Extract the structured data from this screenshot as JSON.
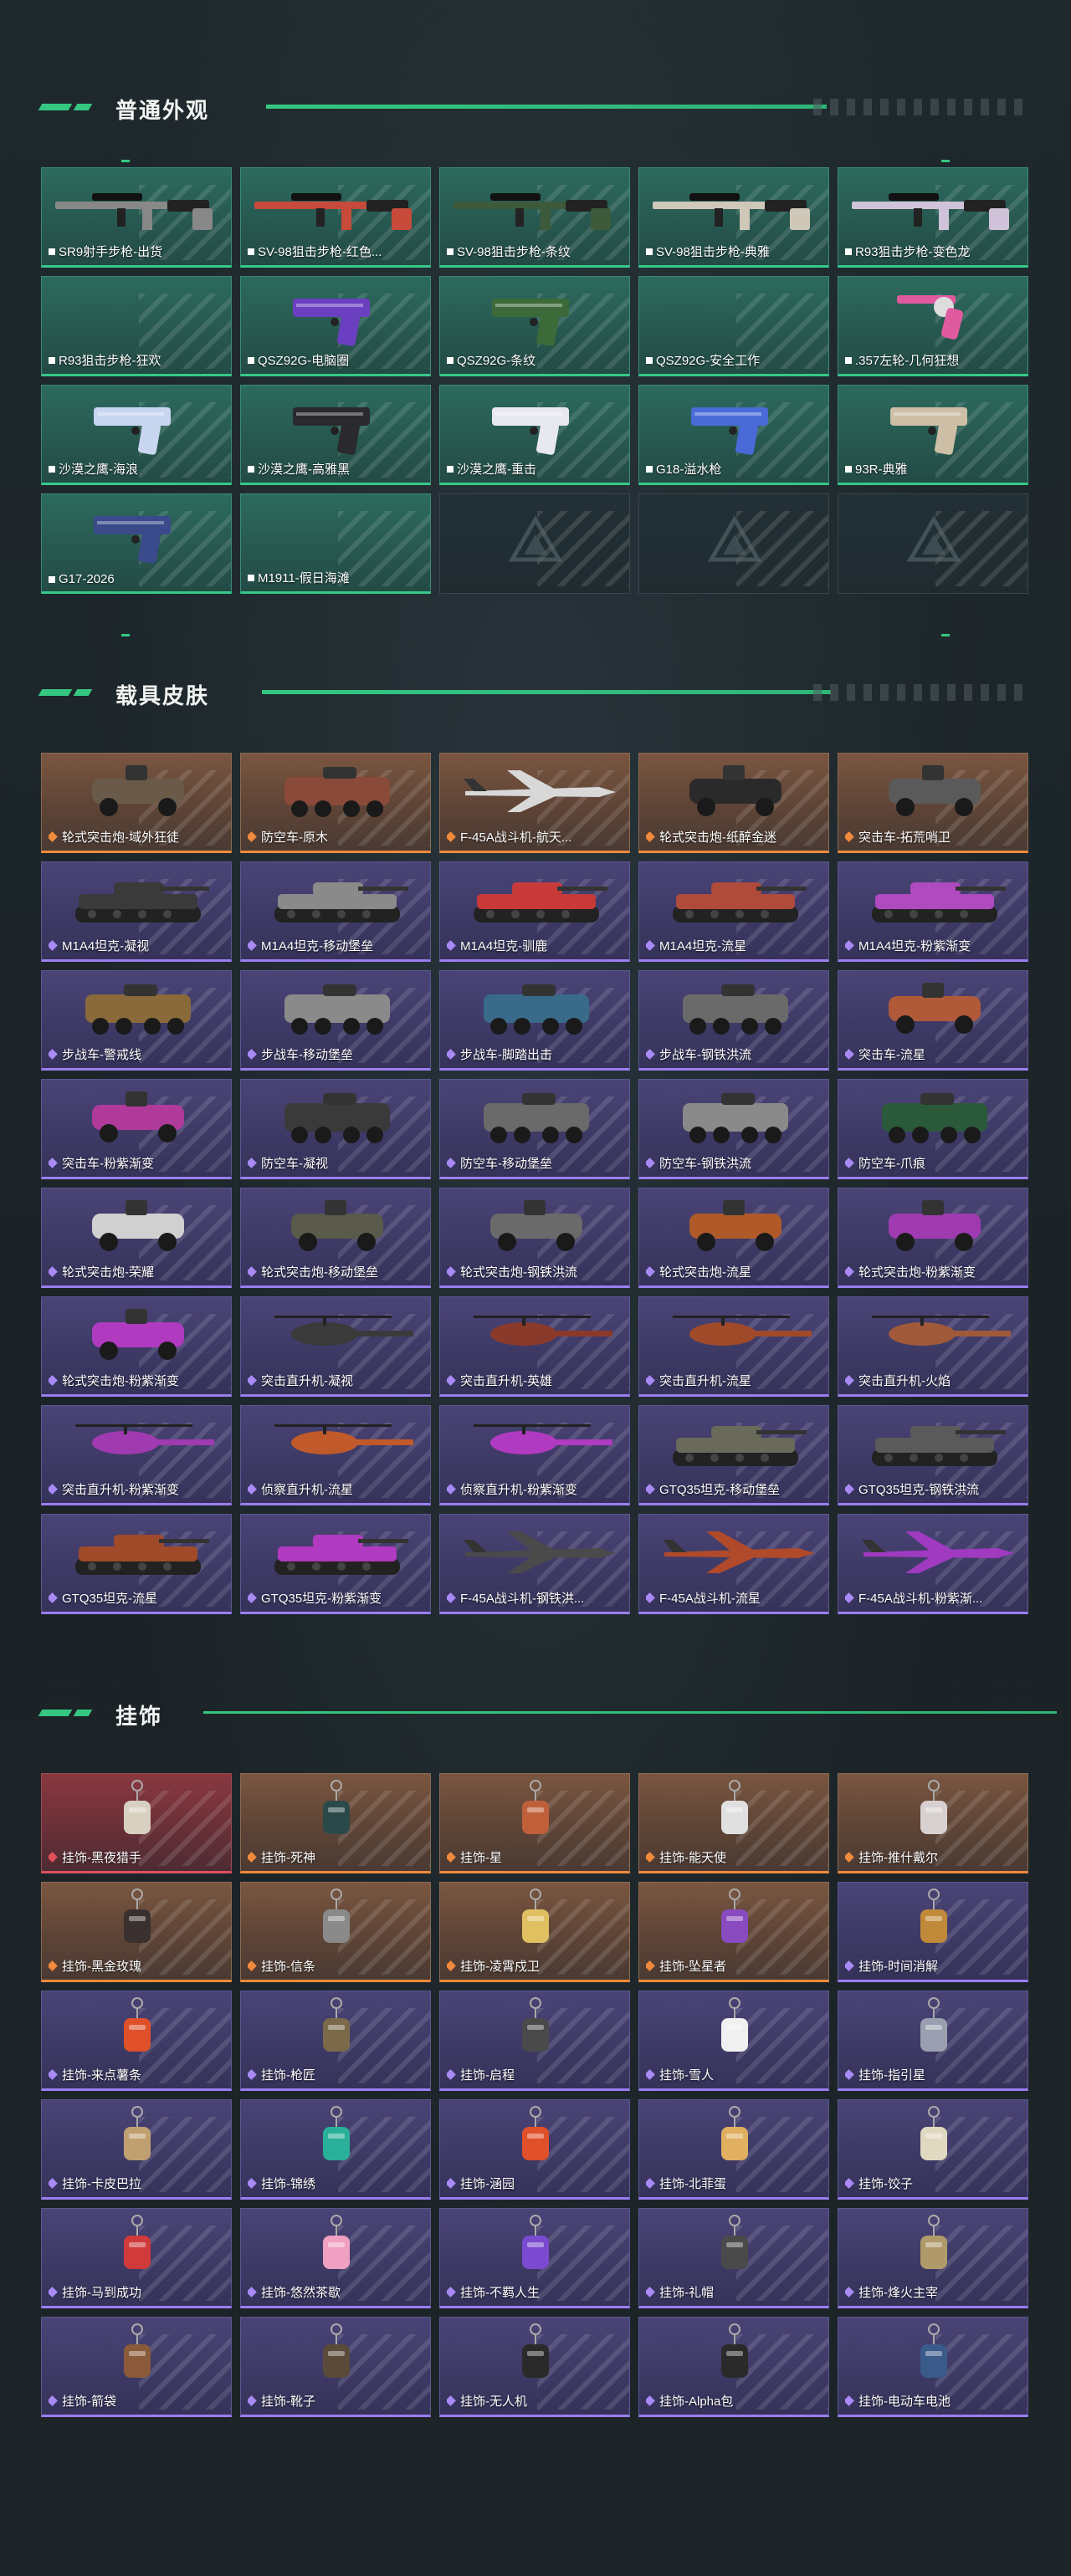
{
  "sections": [
    {
      "title": "普通外观",
      "items": [
        {
          "label": "SR9射手步枪-出货",
          "kind": "rifle",
          "tier": "g"
        },
        {
          "label": "SV-98狙击步枪-红色...",
          "kind": "rifle",
          "tier": "g",
          "color": "#c74a3a"
        },
        {
          "label": "SV-98狙击步枪-条纹",
          "kind": "rifle",
          "tier": "g",
          "color": "#3d5a3a"
        },
        {
          "label": "SV-98狙击步枪-典雅",
          "kind": "rifle",
          "tier": "g",
          "color": "#cfc7b8"
        },
        {
          "label": "R93狙击步枪-变色龙",
          "kind": "rifle",
          "tier": "g",
          "color": "#d0c2d8"
        },
        {
          "label": "R93狙击步枪-狂欢",
          "kind": "none",
          "tier": "g"
        },
        {
          "label": "QSZ92G-电脑圈",
          "kind": "pistol",
          "tier": "g",
          "color": "#6a3fc0"
        },
        {
          "label": "QSZ92G-条纹",
          "kind": "pistol",
          "tier": "g",
          "color": "#3c6a38"
        },
        {
          "label": "QSZ92G-安全工作",
          "kind": "none",
          "tier": "g"
        },
        {
          "label": ".357左轮-几何狂想",
          "kind": "revolver",
          "tier": "g",
          "color": "#e05aa0"
        },
        {
          "label": "沙漠之鹰-海浪",
          "kind": "pistol",
          "tier": "g",
          "color": "#c8d6f0"
        },
        {
          "label": "沙漠之鹰-高雅黑",
          "kind": "pistol",
          "tier": "g",
          "color": "#2a2a2e"
        },
        {
          "label": "沙漠之鹰-重击",
          "kind": "pistol",
          "tier": "g",
          "color": "#e8e8f0"
        },
        {
          "label": "G18-溢水枪",
          "kind": "pistol",
          "tier": "g",
          "color": "#4a6ad8"
        },
        {
          "label": "93R-典雅",
          "kind": "pistol",
          "tier": "g",
          "color": "#cdbfa6"
        },
        {
          "label": "G17-2026",
          "kind": "pistol",
          "tier": "g",
          "color": "#3a4a8a"
        },
        {
          "label": "M1911-假日海滩",
          "kind": "none",
          "tier": "g"
        },
        {
          "label": "",
          "kind": "empty",
          "tier": "e"
        },
        {
          "label": "",
          "kind": "empty",
          "tier": "e"
        },
        {
          "label": "",
          "kind": "empty",
          "tier": "e"
        }
      ]
    },
    {
      "title": "载具皮肤",
      "items": [
        {
          "label": "轮式突击炮-域外狂徒",
          "kind": "truck",
          "tier": "o",
          "color": "#6a5a4a"
        },
        {
          "label": "防空车-原木",
          "kind": "apc",
          "tier": "o",
          "color": "#8a4a3a"
        },
        {
          "label": "F-45A战斗机-航天...",
          "kind": "jet",
          "tier": "o",
          "color": "#d8d8d8"
        },
        {
          "label": "轮式突击炮-纸醉金迷",
          "kind": "truck",
          "tier": "o",
          "color": "#2a2a2a"
        },
        {
          "label": "突击车-拓荒哨卫",
          "kind": "truck",
          "tier": "o",
          "color": "#5a5a5a"
        },
        {
          "label": "M1A4坦克-凝视",
          "kind": "tank",
          "tier": "p",
          "color": "#3a3a3a"
        },
        {
          "label": "M1A4坦克-移动堡垒",
          "kind": "tank",
          "tier": "p",
          "color": "#8a8a8a"
        },
        {
          "label": "M1A4坦克-驯鹿",
          "kind": "tank",
          "tier": "p",
          "color": "#c83a3a"
        },
        {
          "label": "M1A4坦克-流星",
          "kind": "tank",
          "tier": "p",
          "color": "#b04a3a"
        },
        {
          "label": "M1A4坦克-粉紫渐变",
          "kind": "tank",
          "tier": "p",
          "color": "#b04ac0"
        },
        {
          "label": "步战车-警戒线",
          "kind": "apc",
          "tier": "p",
          "color": "#8a6a3a"
        },
        {
          "label": "步战车-移动堡垒",
          "kind": "apc",
          "tier": "p",
          "color": "#8a8a8a"
        },
        {
          "label": "步战车-脚踏出击",
          "kind": "apc",
          "tier": "p",
          "color": "#3a6a8a"
        },
        {
          "label": "步战车-钢铁洪流",
          "kind": "apc",
          "tier": "p",
          "color": "#6a6a6a"
        },
        {
          "label": "突击车-流星",
          "kind": "truck",
          "tier": "p",
          "color": "#b05a3a"
        },
        {
          "label": "突击车-粉紫渐变",
          "kind": "truck",
          "tier": "p",
          "color": "#b03a9a"
        },
        {
          "label": "防空车-凝视",
          "kind": "apc",
          "tier": "p",
          "color": "#3a3a3a"
        },
        {
          "label": "防空车-移动堡垒",
          "kind": "apc",
          "tier": "p",
          "color": "#6a6a6a"
        },
        {
          "label": "防空车-钢铁洪流",
          "kind": "apc",
          "tier": "p",
          "color": "#8a8a8a"
        },
        {
          "label": "防空车-爪痕",
          "kind": "apc",
          "tier": "p",
          "color": "#2a5a3a"
        },
        {
          "label": "轮式突击炮-荣耀",
          "kind": "truck",
          "tier": "p",
          "color": "#d0d0d0"
        },
        {
          "label": "轮式突击炮-移动堡垒",
          "kind": "truck",
          "tier": "p",
          "color": "#5a5a4a"
        },
        {
          "label": "轮式突击炮-钢铁洪流",
          "kind": "truck",
          "tier": "p",
          "color": "#6a6a6a"
        },
        {
          "label": "轮式突击炮-流星",
          "kind": "truck",
          "tier": "p",
          "color": "#b05a2a"
        },
        {
          "label": "轮式突击炮-粉紫渐变",
          "kind": "truck",
          "tier": "p",
          "color": "#a03ab0"
        },
        {
          "label": "轮式突击炮-粉紫渐变",
          "kind": "truck",
          "tier": "p",
          "color": "#b03ac0"
        },
        {
          "label": "突击直升机-凝视",
          "kind": "heli",
          "tier": "p",
          "color": "#3a3a3a"
        },
        {
          "label": "突击直升机-英雄",
          "kind": "heli",
          "tier": "p",
          "color": "#8a3a2a"
        },
        {
          "label": "突击直升机-流星",
          "kind": "heli",
          "tier": "p",
          "color": "#a04a2a"
        },
        {
          "label": "突击直升机-火焰",
          "kind": "heli",
          "tier": "p",
          "color": "#a05a3a"
        },
        {
          "label": "突击直升机-粉紫渐变",
          "kind": "heli",
          "tier": "p",
          "color": "#a03ab0"
        },
        {
          "label": "侦察直升机-流星",
          "kind": "heli",
          "tier": "p",
          "color": "#c05a2a"
        },
        {
          "label": "侦察直升机-粉紫渐变",
          "kind": "heli",
          "tier": "p",
          "color": "#b03ac0"
        },
        {
          "label": "GTQ35坦克-移动堡垒",
          "kind": "tank",
          "tier": "p",
          "color": "#6a6a5a"
        },
        {
          "label": "GTQ35坦克-钢铁洪流",
          "kind": "tank",
          "tier": "p",
          "color": "#5a5a5a"
        },
        {
          "label": "GTQ35坦克-流星",
          "kind": "tank",
          "tier": "p",
          "color": "#a04a2a"
        },
        {
          "label": "GTQ35坦克-粉紫渐变",
          "kind": "tank",
          "tier": "p",
          "color": "#b03ac0"
        },
        {
          "label": "F-45A战斗机-钢铁洪...",
          "kind": "jet",
          "tier": "p",
          "color": "#4a4a4a"
        },
        {
          "label": "F-45A战斗机-流星",
          "kind": "jet",
          "tier": "p",
          "color": "#b04a2a"
        },
        {
          "label": "F-45A战斗机-粉紫渐...",
          "kind": "jet",
          "tier": "p",
          "color": "#a03ac0"
        }
      ]
    },
    {
      "title": "挂饰",
      "items": [
        {
          "label": "挂饰-黑夜猎手",
          "kind": "charm",
          "tier": "r",
          "color": "#d8d0c0"
        },
        {
          "label": "挂饰-死神",
          "kind": "charm",
          "tier": "o",
          "color": "#2a4a4a"
        },
        {
          "label": "挂饰-星",
          "kind": "charm",
          "tier": "o",
          "color": "#c0603a"
        },
        {
          "label": "挂饰-能天使",
          "kind": "charm",
          "tier": "o",
          "color": "#e0e0e0"
        },
        {
          "label": "挂饰-推什戴尔",
          "kind": "charm",
          "tier": "o",
          "color": "#d8d0d0"
        },
        {
          "label": "挂饰-黑金玫瑰",
          "kind": "charm",
          "tier": "o",
          "color": "#3a3030"
        },
        {
          "label": "挂饰-信条",
          "kind": "charm",
          "tier": "o",
          "color": "#8a8a8a"
        },
        {
          "label": "挂饰-凌霄戍卫",
          "kind": "charm",
          "tier": "o",
          "color": "#e0c060"
        },
        {
          "label": "挂饰-坠星者",
          "kind": "charm",
          "tier": "o",
          "color": "#8a4ac0"
        },
        {
          "label": "挂饰-时间消解",
          "kind": "charm",
          "tier": "p",
          "color": "#c08a3a"
        },
        {
          "label": "挂饰-来点薯条",
          "kind": "charm",
          "tier": "p",
          "color": "#e0502a"
        },
        {
          "label": "挂饰-枪匠",
          "kind": "charm",
          "tier": "p",
          "color": "#7a6a4a"
        },
        {
          "label": "挂饰-启程",
          "kind": "charm",
          "tier": "p",
          "color": "#4a4a4a"
        },
        {
          "label": "挂饰-雪人",
          "kind": "charm",
          "tier": "p",
          "color": "#f0f0f0"
        },
        {
          "label": "挂饰-指引星",
          "kind": "charm",
          "tier": "p",
          "color": "#9aa0b0"
        },
        {
          "label": "挂饰-卡皮巴拉",
          "kind": "charm",
          "tier": "p",
          "color": "#c0a070"
        },
        {
          "label": "挂饰-锦绣",
          "kind": "charm",
          "tier": "p",
          "color": "#2ab09a"
        },
        {
          "label": "挂饰-涵园",
          "kind": "charm",
          "tier": "p",
          "color": "#e0502a"
        },
        {
          "label": "挂饰-北菲蛋",
          "kind": "charm",
          "tier": "p",
          "color": "#e0b060"
        },
        {
          "label": "挂饰-饺子",
          "kind": "charm",
          "tier": "p",
          "color": "#e0d8c0"
        },
        {
          "label": "挂饰-马到成功",
          "kind": "charm",
          "tier": "p",
          "color": "#d03a3a"
        },
        {
          "label": "挂饰-悠然茶歇",
          "kind": "charm",
          "tier": "p",
          "color": "#f0a0c0"
        },
        {
          "label": "挂饰-不羁人生",
          "kind": "charm",
          "tier": "p",
          "color": "#7a4ad0"
        },
        {
          "label": "挂饰-礼帽",
          "kind": "charm",
          "tier": "p",
          "color": "#4a4a4a"
        },
        {
          "label": "挂饰-烽火主宰",
          "kind": "charm",
          "tier": "p",
          "color": "#b09a6a"
        },
        {
          "label": "挂饰-箭袋",
          "kind": "charm",
          "tier": "p",
          "color": "#8a5a3a"
        },
        {
          "label": "挂饰-靴子",
          "kind": "charm",
          "tier": "p",
          "color": "#5a4a3a"
        },
        {
          "label": "挂饰-无人机",
          "kind": "charm",
          "tier": "p",
          "color": "#2a2a2a"
        },
        {
          "label": "挂饰-Alpha包",
          "kind": "charm",
          "tier": "p",
          "color": "#2a2a2a"
        },
        {
          "label": "挂饰-电动车电池",
          "kind": "charm",
          "tier": "p",
          "color": "#3a5a8a"
        }
      ]
    }
  ]
}
